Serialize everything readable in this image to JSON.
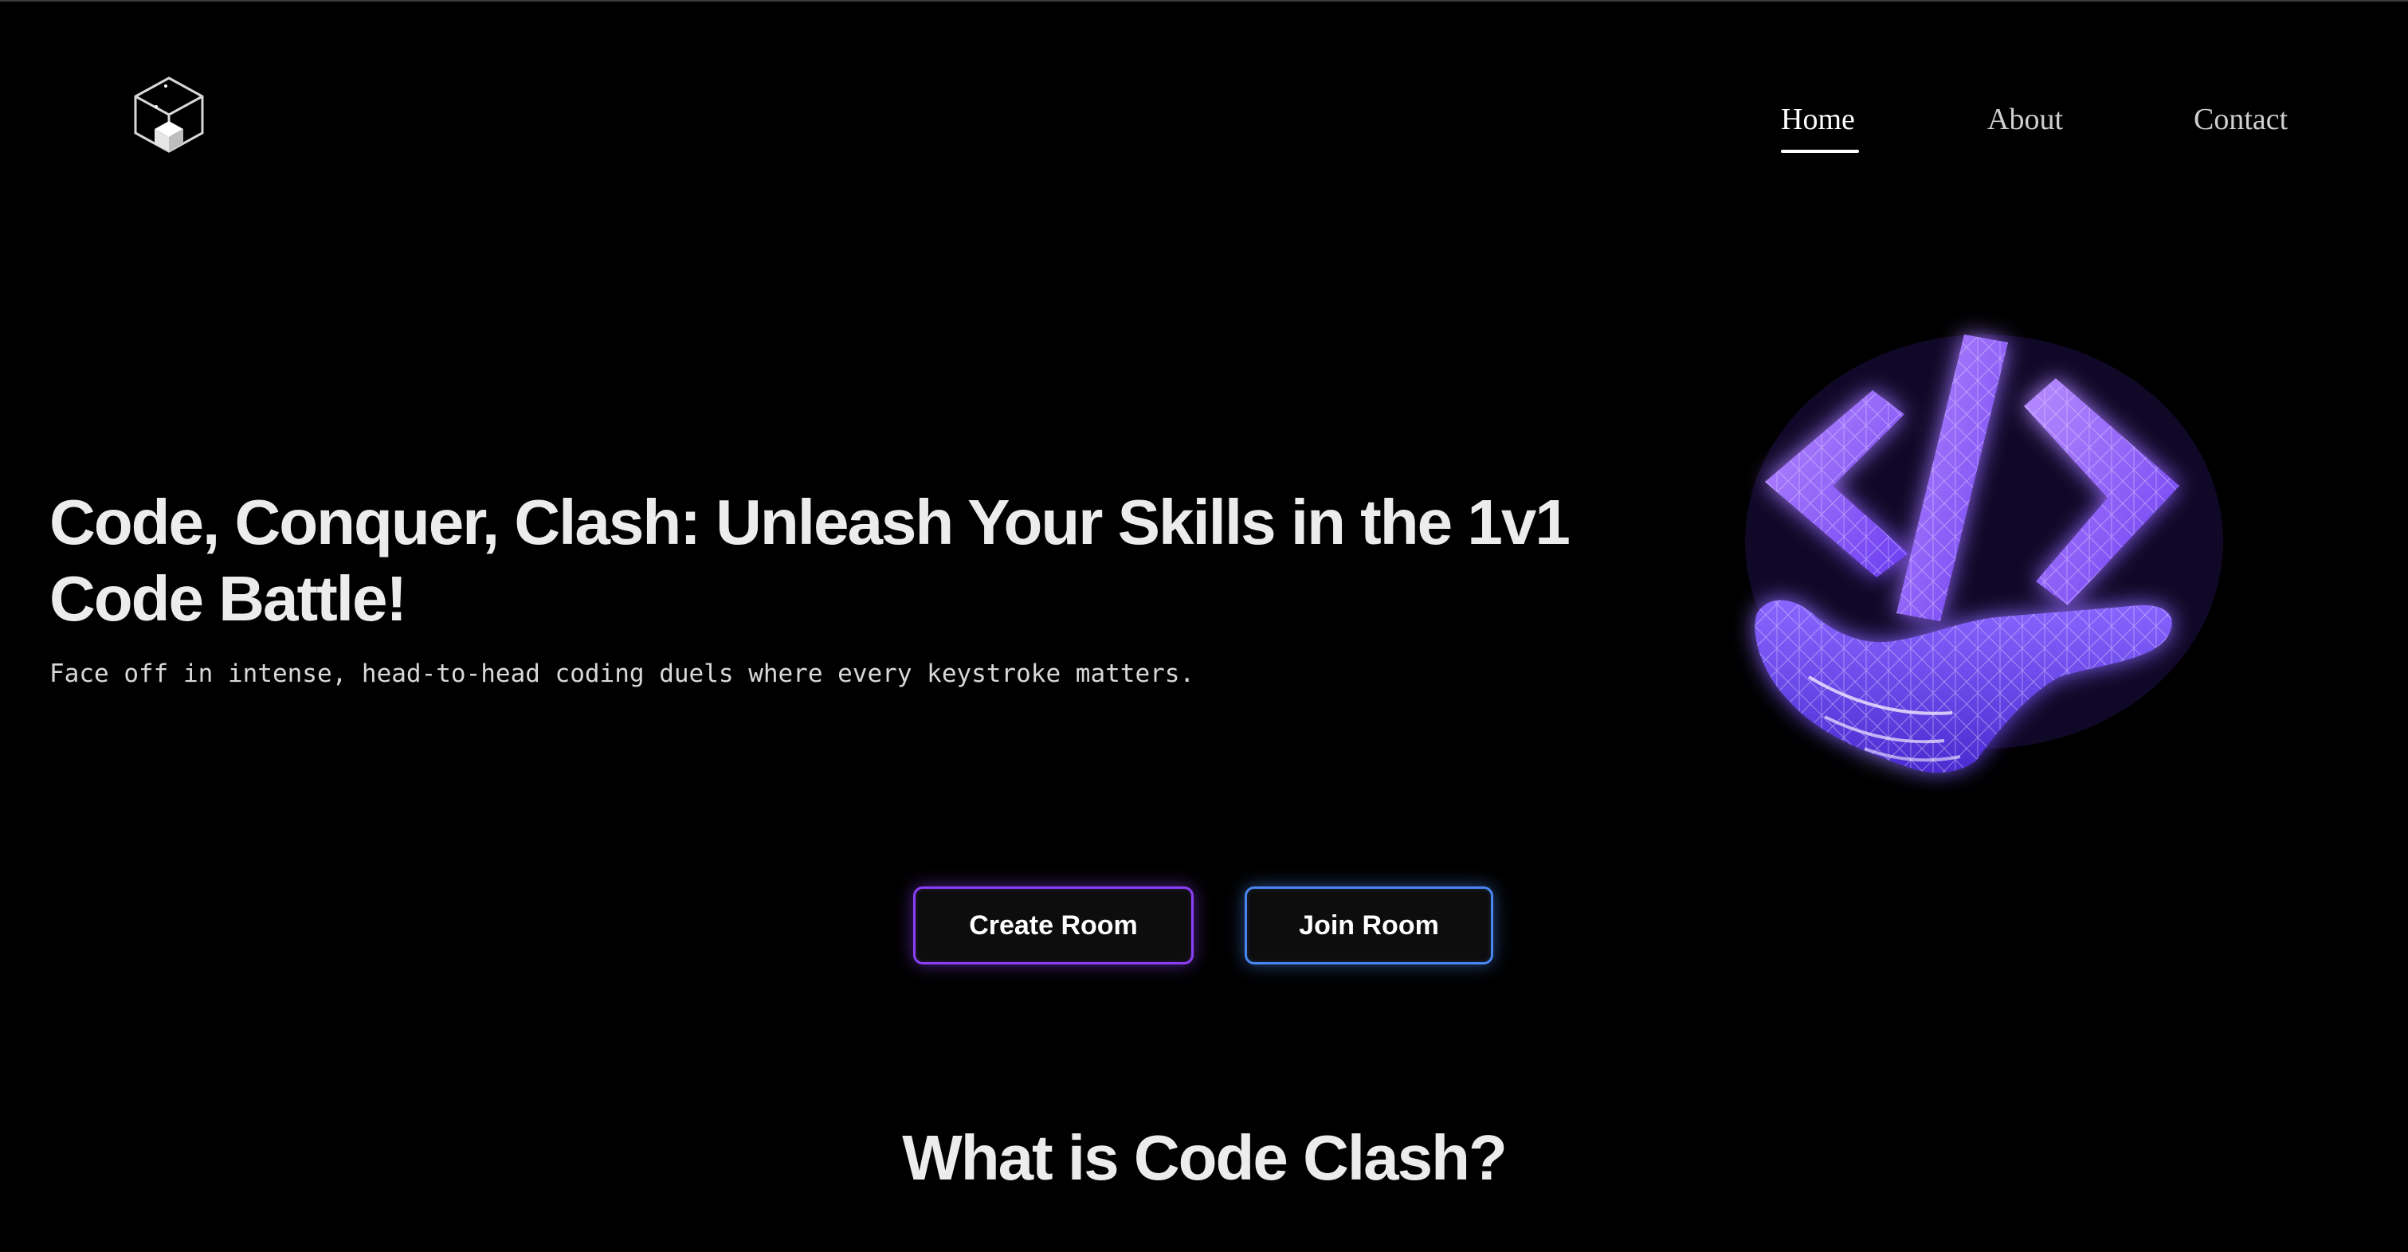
{
  "brand": {
    "logo_icon": "cube-logo-icon"
  },
  "nav": {
    "items": [
      {
        "label": "Home",
        "active": true
      },
      {
        "label": "About",
        "active": false
      },
      {
        "label": "Contact",
        "active": false
      }
    ]
  },
  "hero": {
    "title": "Code, Conquer, Clash: Unleash Your Skills in the 1v1 Code Battle!",
    "subtitle": "Face off in intense, head-to-head coding duels where every keystroke matters.",
    "illustration_icon": "hand-holding-code-brackets-icon"
  },
  "actions": {
    "create_label": "Create Room",
    "join_label": "Join Room"
  },
  "about": {
    "heading": "What is Code Clash?"
  },
  "colors": {
    "background": "#000000",
    "text": "#ececec",
    "create_border": "#8b3ff5",
    "join_border": "#4a86f0",
    "illustration_purple": "#7b4dff"
  }
}
